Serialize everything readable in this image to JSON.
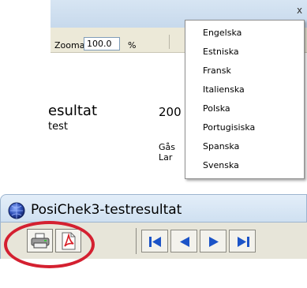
{
  "viewer": {
    "zoom_label": "Zooma",
    "zoom_value": "100.0",
    "zoom_unit": "%",
    "close_glyph": "x"
  },
  "report": {
    "title_fragment": "esultat",
    "subtitle_fragment": "test",
    "year_fragment": "200",
    "line1_fragment": "Gås",
    "line2_fragment": "Lar"
  },
  "language_menu": {
    "items": [
      "Engelska",
      "Estniska",
      "Fransk",
      "Italienska",
      "Polska",
      "Portugisiska",
      "Spanska",
      "Svenska"
    ]
  },
  "window": {
    "title": "PosiChek3-testresultat",
    "title_icon": "app-globe-icon"
  },
  "toolbar": {
    "buttons": [
      "print-icon",
      "pdf-icon",
      "first-page-icon",
      "previous-page-icon",
      "next-page-icon",
      "last-page-icon"
    ]
  },
  "colors": {
    "highlight": "#d42030",
    "pdf_red": "#d81f26",
    "nav_blue": "#1b53c7"
  }
}
